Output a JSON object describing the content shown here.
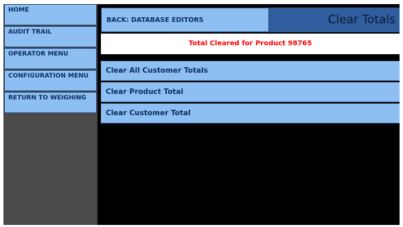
{
  "sidebar": {
    "items": [
      {
        "label": "HOME"
      },
      {
        "label": "AUDIT TRAIL"
      },
      {
        "label": "OPERATOR MENU"
      },
      {
        "label": "CONFIGURATION MENU"
      },
      {
        "label": "RETURN TO WEIGHING"
      }
    ]
  },
  "header": {
    "back_label": "BACK: DATABASE EDITORS",
    "title": "Clear Totals"
  },
  "status": {
    "message": "Total Cleared for Product 98765"
  },
  "actions": [
    {
      "label": "Clear All Customer Totals"
    },
    {
      "label": "Clear Product Total"
    },
    {
      "label": "Clear Customer Total"
    }
  ],
  "colors": {
    "button_bg": "#8ebff2",
    "title_bg": "#2f5d9e",
    "sidebar_bg": "#4a4a4a",
    "status_text": "#ff0000"
  }
}
